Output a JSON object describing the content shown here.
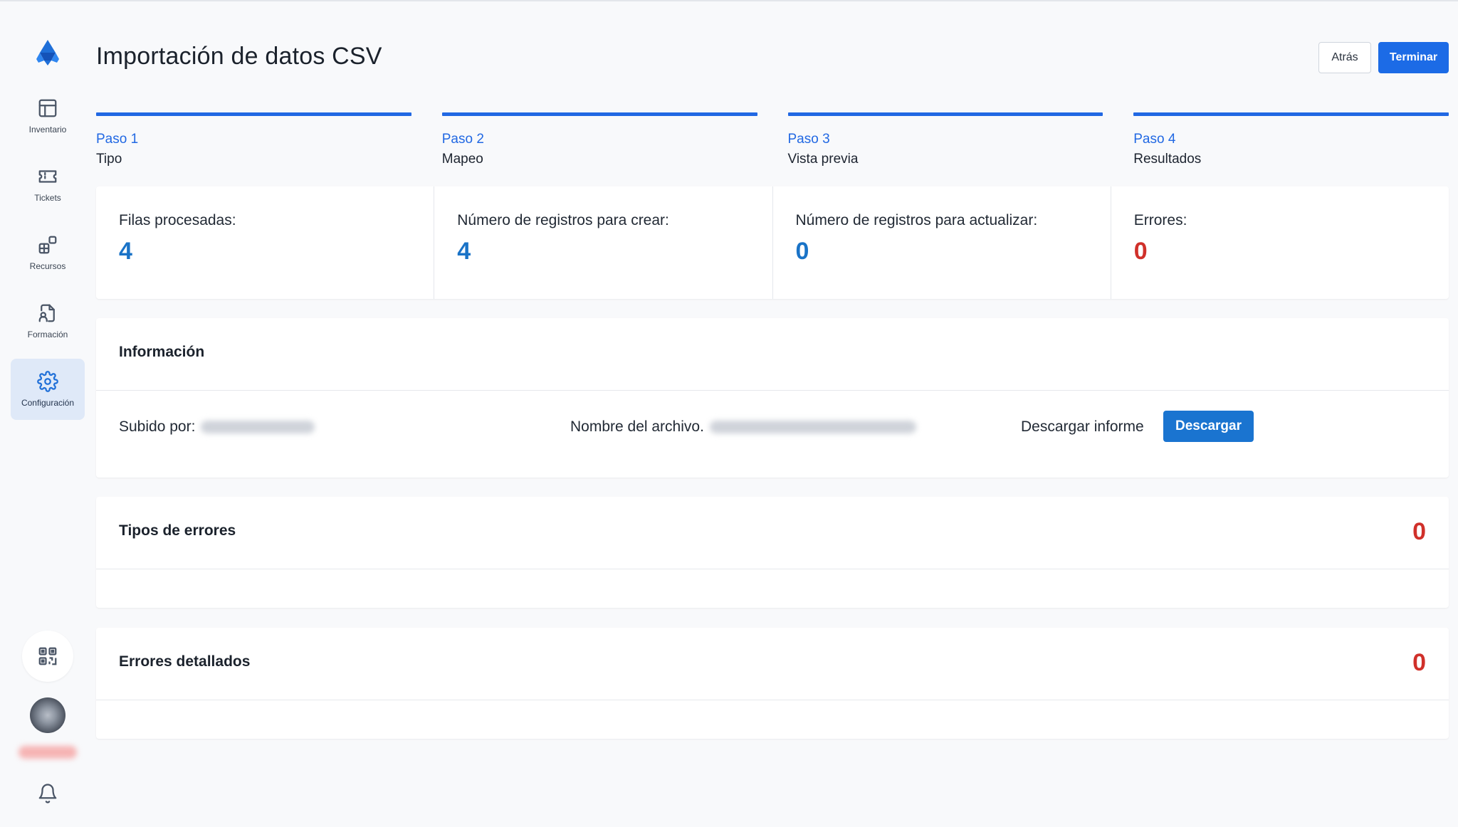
{
  "sidebar": {
    "items": [
      {
        "label": "Inventario",
        "icon": "grid-icon"
      },
      {
        "label": "Tickets",
        "icon": "ticket-icon"
      },
      {
        "label": "Recursos",
        "icon": "resources-icon"
      },
      {
        "label": "Formación",
        "icon": "training-icon"
      },
      {
        "label": "Configuración",
        "icon": "gear-icon",
        "active": true
      }
    ],
    "accent": "#1f6fd8"
  },
  "header": {
    "title": "Importación de datos CSV",
    "back_label": "Atrás",
    "finish_label": "Terminar"
  },
  "steps": [
    {
      "number": "Paso 1",
      "name": "Tipo"
    },
    {
      "number": "Paso 2",
      "name": "Mapeo"
    },
    {
      "number": "Paso 3",
      "name": "Vista previa"
    },
    {
      "number": "Paso 4",
      "name": "Resultados"
    }
  ],
  "stats": [
    {
      "label": "Filas procesadas:",
      "value": "4"
    },
    {
      "label": "Número de registros para crear:",
      "value": "4"
    },
    {
      "label": "Número de registros para actualizar:",
      "value": "0"
    },
    {
      "label": "Errores:",
      "value": "0"
    }
  ],
  "info": {
    "title": "Información",
    "uploaded_by_label": "Subido por:",
    "file_name_label": "Nombre del archivo.",
    "download_report_label": "Descargar informe",
    "download_button": "Descargar"
  },
  "error_types": {
    "title": "Tipos de errores",
    "count": "0"
  },
  "detailed_errors": {
    "title": "Errores detallados",
    "count": "0"
  },
  "colors": {
    "primary": "#1c6be6",
    "value": "#1a73c7",
    "error": "#d0302a"
  }
}
